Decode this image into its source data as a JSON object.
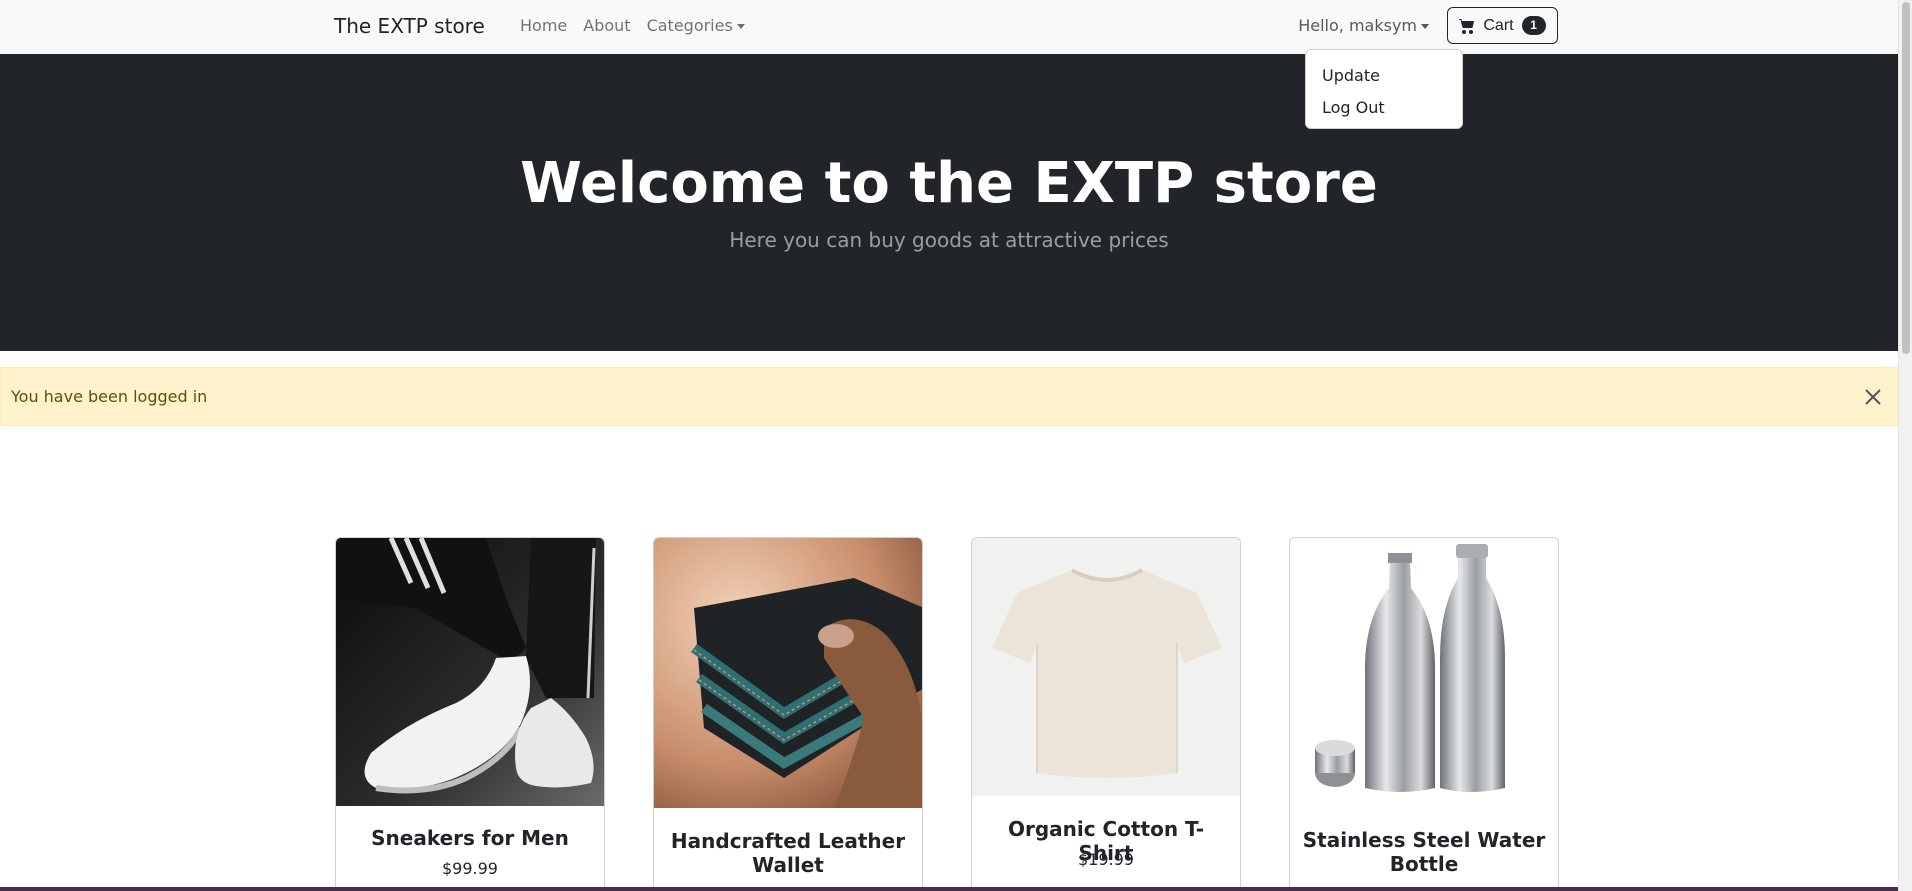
{
  "navbar": {
    "brand": "The EXTP store",
    "links": [
      "Home",
      "About"
    ],
    "categories_label": "Categories",
    "user_label": "Hello, maksym",
    "cart_label": "Cart",
    "cart_count": "1"
  },
  "user_menu": {
    "items": [
      "Update",
      "Log Out"
    ]
  },
  "hero": {
    "title": "Welcome to the EXTP store",
    "subtitle": "Here you can buy goods at attractive prices"
  },
  "alert": {
    "message": "You have been logged in"
  },
  "products": [
    {
      "title": "Sneakers for Men",
      "price": "$99.99"
    },
    {
      "title": "Handcrafted Leather Wallet",
      "price": ""
    },
    {
      "title": "Organic Cotton T-Shirt",
      "price": "$19.99"
    },
    {
      "title": "Stainless Steel Water Bottle",
      "price": ""
    }
  ],
  "colors": {
    "navbar_bg": "#f8f9fa",
    "hero_bg": "#212529",
    "alert_bg": "#fff3cd",
    "alert_text": "#664d03"
  }
}
